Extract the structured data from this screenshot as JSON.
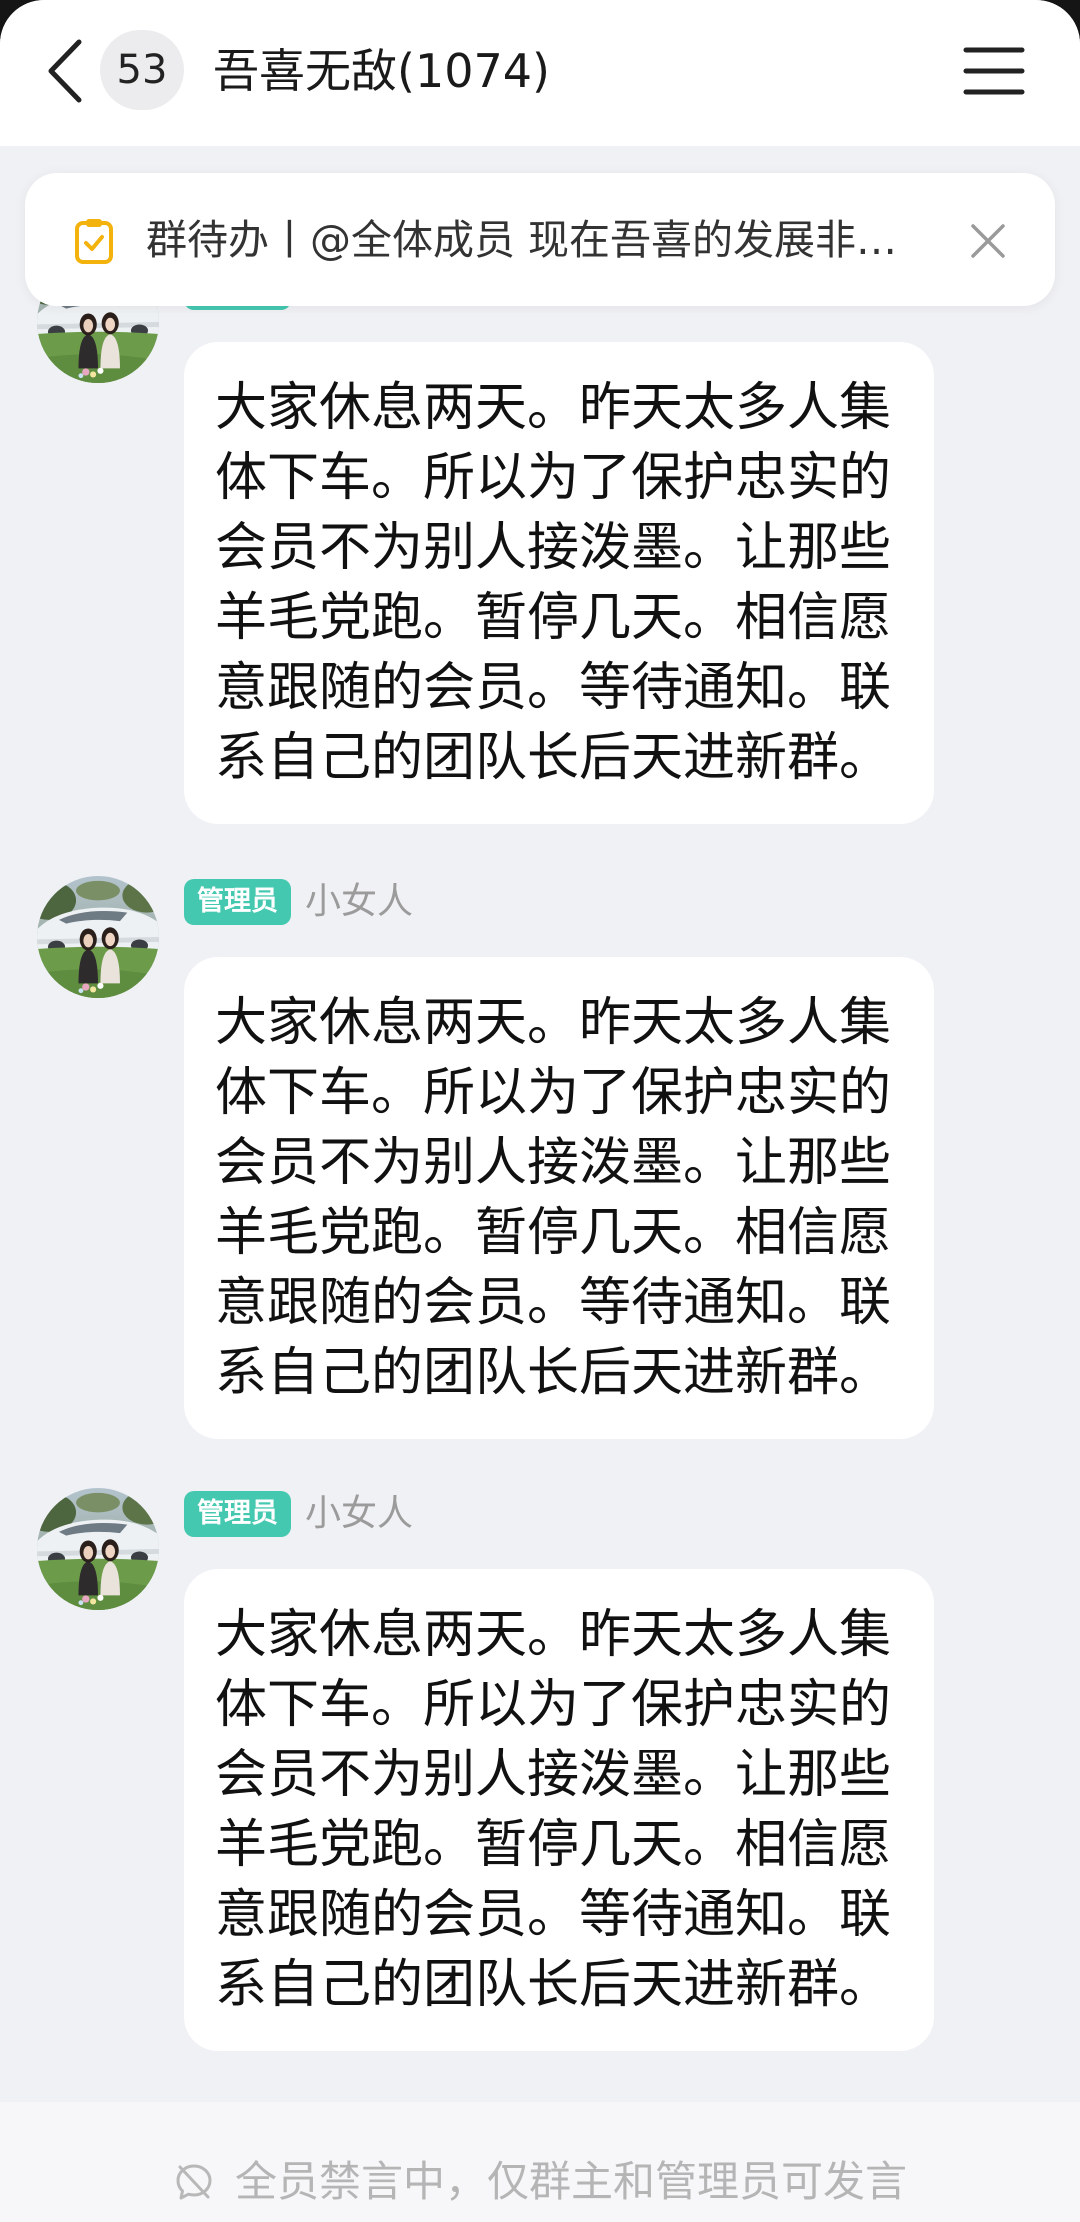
{
  "header": {
    "back_icon": "chevron-left-icon",
    "unread_count": "53",
    "title": "吾喜无敌(1074)",
    "menu_icon": "menu-icon"
  },
  "pinned_todo": {
    "icon": "todo-clipboard-icon",
    "text": "群待办丨@全体成员 现在吾喜的发展非…",
    "close_icon": "close-icon"
  },
  "messages": [
    {
      "text": "大家休息两天。昨天太多人集体下车。所以为了保护忠实的会员不为别人接泼墨。让那些羊毛党跑。暂停几天。相信愿意跟随的会员。等待通知。联系自己的团队长后天进新群。"
    },
    {
      "role_badge": "管理员",
      "sender": "小女人",
      "text": "大家休息两天。昨天太多人集体下车。所以为了保护忠实的会员不为别人接泼墨。让那些羊毛党跑。暂停几天。相信愿意跟随的会员。等待通知。联系自己的团队长后天进新群。"
    },
    {
      "role_badge": "管理员",
      "sender": "小女人",
      "text": "大家休息两天。昨天太多人集体下车。所以为了保护忠实的会员不为别人接泼墨。让那些羊毛党跑。暂停几天。相信愿意跟随的会员。等待通知。联系自己的团队长后天进新群。"
    }
  ],
  "footer": {
    "icon": "mute-icon",
    "muted_notice": "全员禁言中，仅群主和管理员可发言"
  },
  "colors": {
    "chat_background": "#f0f1f5",
    "header_background": "#ffffff",
    "bubble_background": "#ffffff",
    "admin_badge": "#45c8b0",
    "todo_icon": "#f4b20d",
    "muted_text": "#b5b5b5"
  }
}
